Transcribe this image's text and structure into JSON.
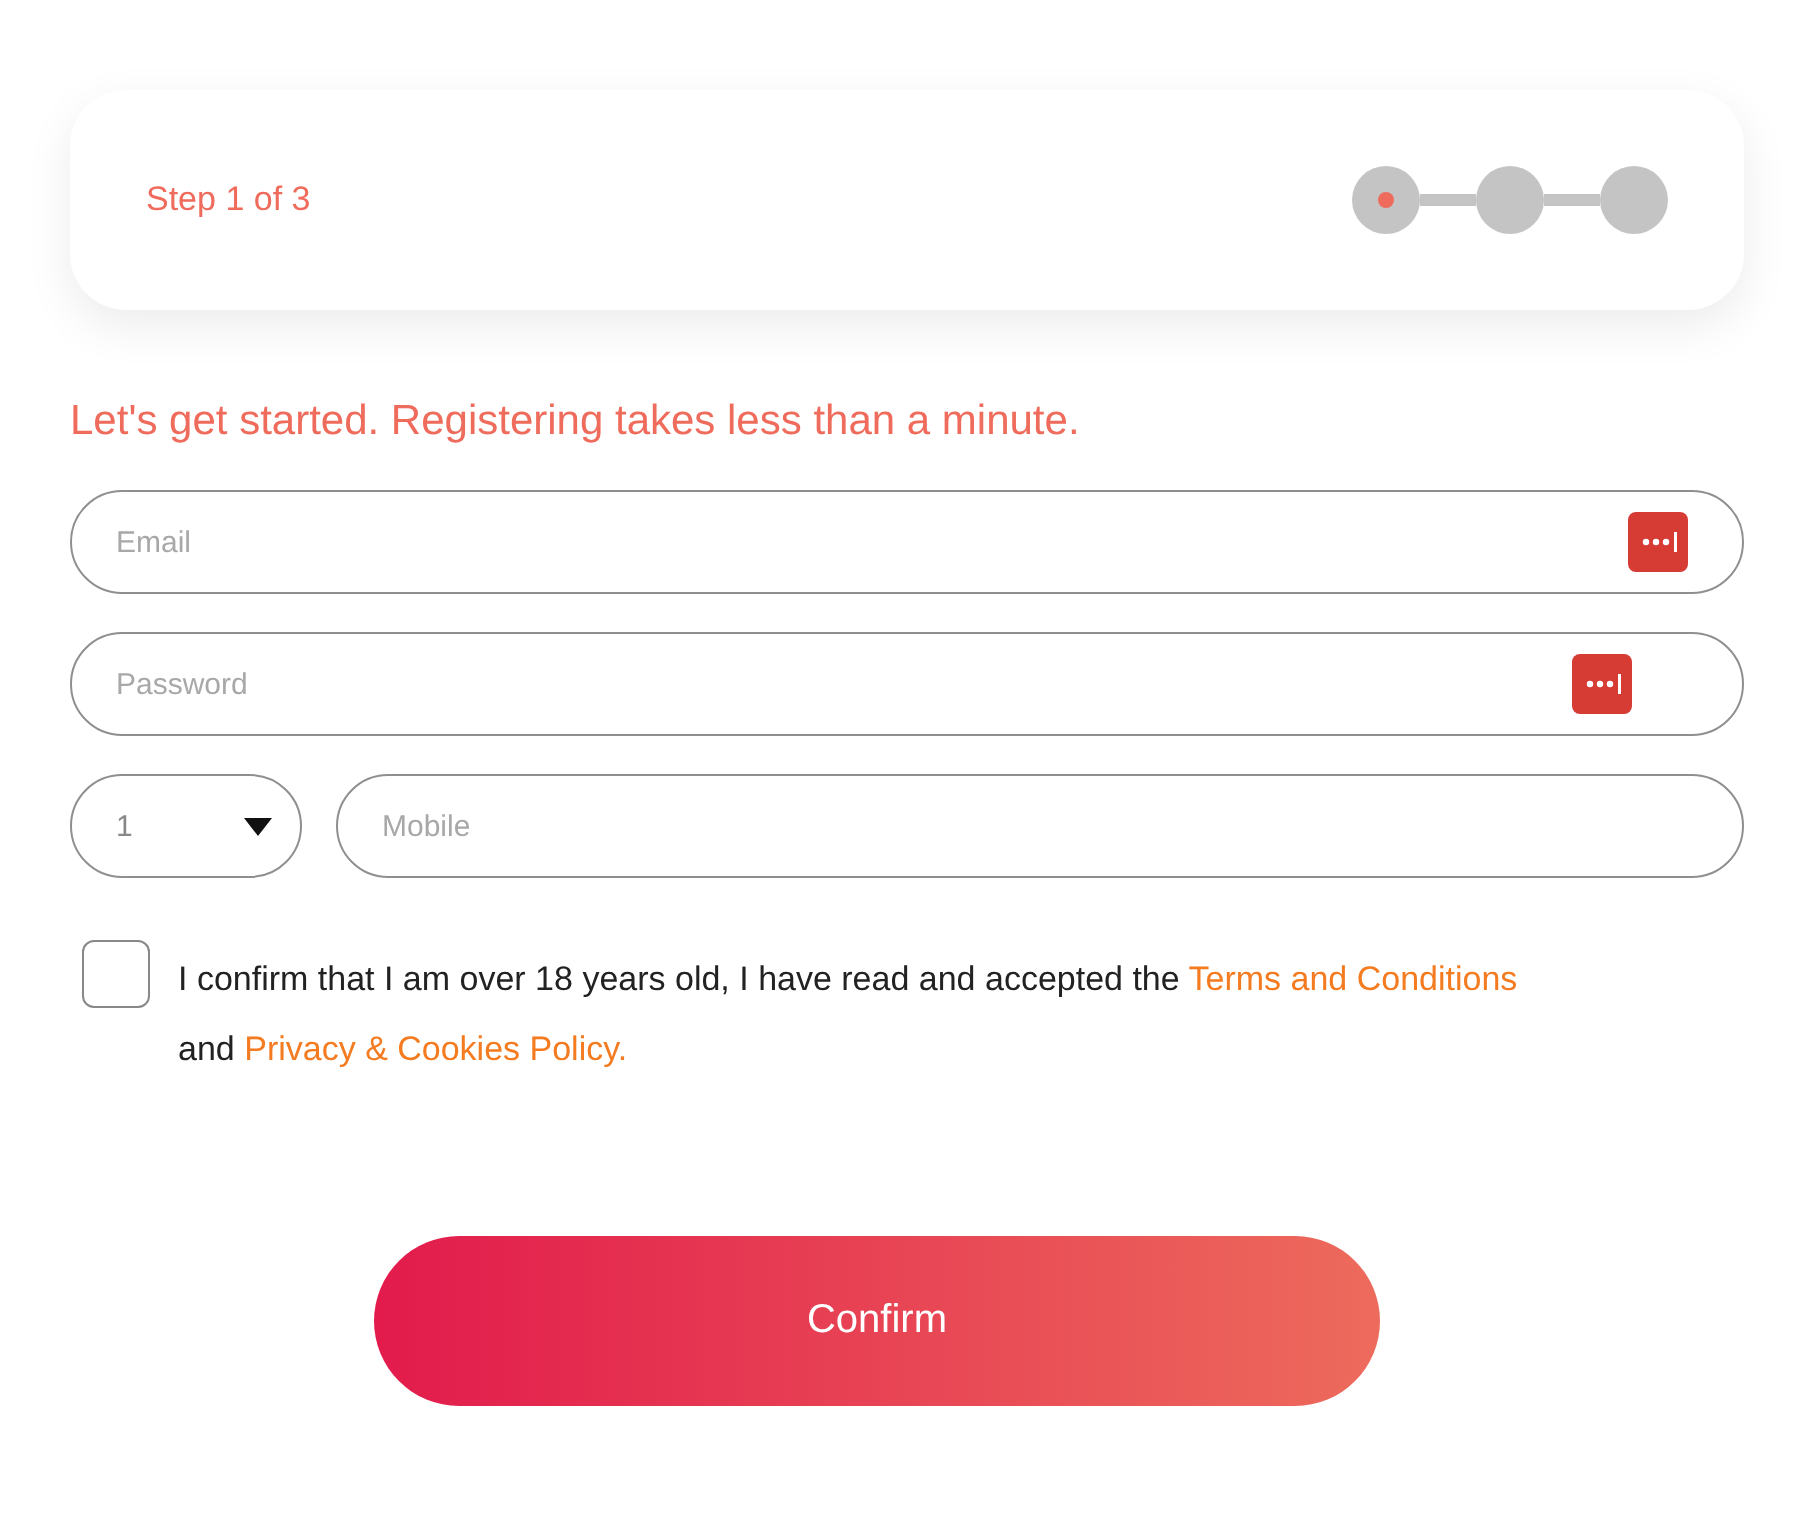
{
  "progress": {
    "label": "Step 1 of 3",
    "steps": [
      {
        "selected": true
      },
      {
        "selected": false
      },
      {
        "selected": false
      }
    ]
  },
  "heading": "Let's get started. Registering takes less than a minute.",
  "fields": [
    {
      "placeholder": "Email",
      "kind": "email"
    },
    {
      "placeholder": "Password",
      "kind": "password"
    }
  ],
  "phone": {
    "code": "1",
    "placeholder": "Mobile"
  },
  "consent": {
    "checked": false,
    "text_before": "I confirm that I am over 18 years old, I have read and accepted the",
    "terms_link": "Terms and Conditions",
    "text_middle": "and",
    "privacy_link": "Privacy & Cookies Policy."
  },
  "confirm_button": "Confirm"
}
